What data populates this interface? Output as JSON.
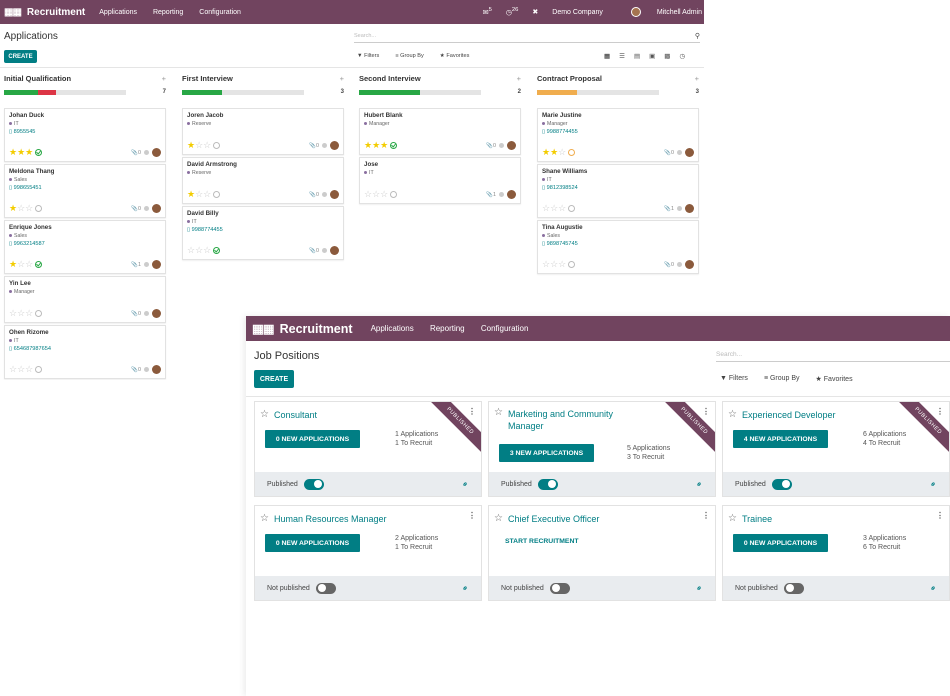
{
  "back": {
    "navbar": {
      "app": "Recruitment",
      "menus": [
        "Applications",
        "Reporting",
        "Configuration"
      ],
      "msg_badge": "5",
      "activity_badge": "26",
      "company": "Demo Company",
      "user": "Mitchell Admin"
    },
    "title": "Applications",
    "create": "CREATE",
    "search_placeholder": "Search...",
    "filters": "Filters",
    "group_by": "Group By",
    "favorites": "Favorites",
    "columns": [
      {
        "name": "Initial Qualification",
        "count": "7",
        "cards": [
          {
            "name": "Johan Duck",
            "tag": "IT",
            "phone": "8955545",
            "stars": 3,
            "act": "ok",
            "att": "0"
          },
          {
            "name": "Meldona Thang",
            "tag": "Sales",
            "phone": "998655451",
            "stars": 1,
            "act": "none",
            "att": "0"
          },
          {
            "name": "Enrique Jones",
            "tag": "Sales",
            "phone": "9963214587",
            "stars": 1,
            "act": "ok",
            "att": "1"
          },
          {
            "name": "Yin Lee",
            "tag": "Manager",
            "phone": "",
            "stars": 0,
            "act": "none",
            "att": "0"
          },
          {
            "name": "Ohen Rizome",
            "tag": "IT",
            "phone": "654687987654",
            "stars": 0,
            "act": "none",
            "att": "0"
          }
        ]
      },
      {
        "name": "First Interview",
        "count": "3",
        "cards": [
          {
            "name": "Joren Jacob",
            "tag": "Reserve",
            "phone": "",
            "stars": 1,
            "act": "none",
            "att": "0"
          },
          {
            "name": "David Armstrong",
            "tag": "Reserve",
            "phone": "",
            "stars": 1,
            "act": "none",
            "att": "0"
          },
          {
            "name": "David Billy",
            "tag": "IT",
            "phone": "9988774455",
            "stars": 0,
            "act": "ok",
            "att": "0"
          }
        ]
      },
      {
        "name": "Second Interview",
        "count": "2",
        "cards": [
          {
            "name": "Hubert Blank",
            "tag": "Manager",
            "phone": "",
            "stars": 3,
            "act": "ok",
            "att": "0"
          },
          {
            "name": "Jose",
            "tag": "IT",
            "phone": "",
            "stars": 0,
            "act": "none",
            "att": "1"
          }
        ]
      },
      {
        "name": "Contract Proposal",
        "count": "3",
        "cards": [
          {
            "name": "Marie Justine",
            "tag": "Manager",
            "phone": "9988774455",
            "stars": 2,
            "act": "warn",
            "att": "0"
          },
          {
            "name": "Shane Williams",
            "tag": "IT",
            "phone": "9812398524",
            "stars": 0,
            "act": "none",
            "att": "1"
          },
          {
            "name": "Tina Augustie",
            "tag": "Sales",
            "phone": "9898745745",
            "stars": 0,
            "act": "none",
            "att": "0"
          }
        ]
      }
    ],
    "progress": [
      [
        {
          "color": "#28a745",
          "pct": 28
        },
        {
          "color": "#dc3545",
          "pct": 15
        }
      ],
      [
        {
          "color": "#28a745",
          "pct": 33
        }
      ],
      [
        {
          "color": "#28a745",
          "pct": 50
        }
      ],
      [
        {
          "color": "#f0ad4e",
          "pct": 33
        }
      ]
    ]
  },
  "front": {
    "navbar": {
      "app": "Recruitment",
      "menus": [
        "Applications",
        "Reporting",
        "Configuration"
      ]
    },
    "title": "Job Positions",
    "create": "CREATE",
    "search_placeholder": "Search...",
    "filters": "Filters",
    "group_by": "Group By",
    "favorites": "Favorites",
    "jobs": [
      {
        "title": "Consultant",
        "button": "0 NEW APPLICATIONS",
        "applications": "1 Applications",
        "recruit": "1 To Recruit",
        "published": true,
        "status": "Published",
        "ribbon": "PUBLISHED"
      },
      {
        "title": "Marketing and Community Manager",
        "button": "3 NEW APPLICATIONS",
        "applications": "5 Applications",
        "recruit": "3 To Recruit",
        "published": true,
        "status": "Published",
        "ribbon": "PUBLISHED"
      },
      {
        "title": "Experienced Developer",
        "button": "4 NEW APPLICATIONS",
        "applications": "6 Applications",
        "recruit": "4 To Recruit",
        "published": true,
        "status": "Published",
        "ribbon": "PUBLISHED"
      },
      {
        "title": "Human Resources Manager",
        "button": "0 NEW APPLICATIONS",
        "applications": "2 Applications",
        "recruit": "1 To Recruit",
        "published": false,
        "status": "Not published",
        "ribbon": ""
      },
      {
        "title": "Chief Executive Officer",
        "button": "START RECRUITMENT",
        "applications": "",
        "recruit": "",
        "published": false,
        "status": "Not published",
        "ribbon": ""
      },
      {
        "title": "Trainee",
        "button": "0 NEW APPLICATIONS",
        "applications": "3 Applications",
        "recruit": "6 To Recruit",
        "published": false,
        "status": "Not published",
        "ribbon": ""
      }
    ]
  },
  "colors": {
    "brand": "#71445f",
    "accent": "#017e84",
    "star": "#f3cc00"
  }
}
